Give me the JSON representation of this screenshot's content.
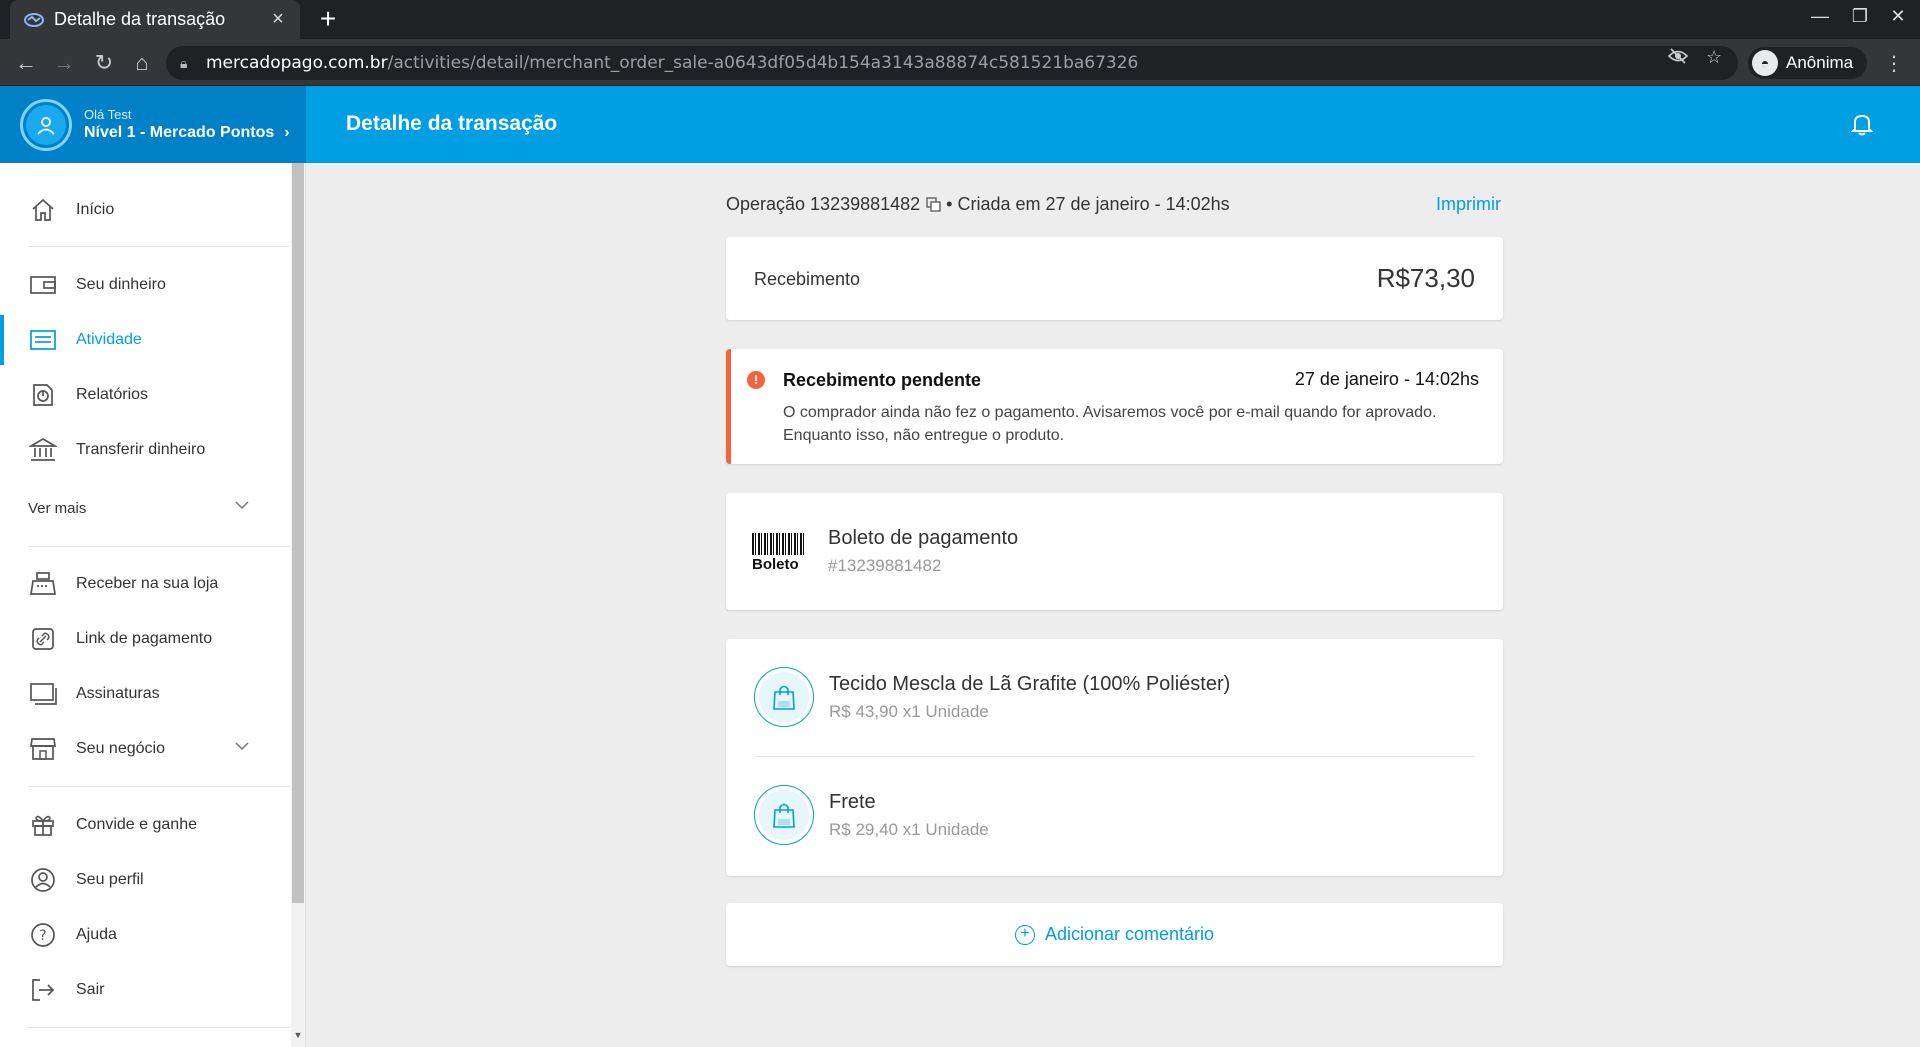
{
  "browser": {
    "tab_title": "Detalhe da transação",
    "url_host": "mercadopago.com.br",
    "url_path": "/activities/detail/merchant_order_sale-a0643df05d4b154a3143a88874c581521ba67326",
    "profile_label": "Anônima"
  },
  "header": {
    "greeting": "Olá Test",
    "level": "Nível 1 - Mercado Pontos",
    "page_title": "Detalhe da transação"
  },
  "sidebar": {
    "items": [
      {
        "label": "Início",
        "icon": "home-icon"
      },
      {
        "label": "Seu dinheiro",
        "icon": "wallet-icon"
      },
      {
        "label": "Atividade",
        "icon": "activity-icon",
        "active": true
      },
      {
        "label": "Relatórios",
        "icon": "report-icon"
      },
      {
        "label": "Transferir dinheiro",
        "icon": "bank-icon"
      },
      {
        "label": "Ver mais",
        "icon": "chevron-down-icon"
      },
      {
        "label": "Receber na sua loja",
        "icon": "cash-register-icon"
      },
      {
        "label": "Link de pagamento",
        "icon": "link-icon"
      },
      {
        "label": "Assinaturas",
        "icon": "subscriptions-icon"
      },
      {
        "label": "Seu negócio",
        "icon": "store-icon"
      },
      {
        "label": "Convide e ganhe",
        "icon": "gift-icon"
      },
      {
        "label": "Seu perfil",
        "icon": "user-icon"
      },
      {
        "label": "Ajuda",
        "icon": "help-icon"
      },
      {
        "label": "Sair",
        "icon": "logout-icon"
      }
    ]
  },
  "content": {
    "operation_prefix": "Operação 13239881482",
    "operation_suffix": "• Criada em 27 de janeiro - 14:02hs",
    "print_label": "Imprimir",
    "receipt_label": "Recebimento",
    "receipt_amount": "R$73,30",
    "pending": {
      "title": "Recebimento pendente",
      "date": "27 de janeiro - 14:02hs",
      "desc": "O comprador ainda não fez o pagamento. Avisaremos você por e-mail quando for aprovado. Enquanto isso, não entregue o produto."
    },
    "boleto": {
      "logo_text": "Boleto",
      "title": "Boleto de pagamento",
      "number": "#13239881482"
    },
    "items": [
      {
        "title": "Tecido Mescla de Lã Grafite (100% Poliéster)",
        "detail": "R$ 43,90 x1 Unidade"
      },
      {
        "title": "Frete",
        "detail": "R$ 29,40 x1 Unidade"
      }
    ],
    "comment_label": "Adicionar comentário"
  },
  "colors": {
    "brand": "#009ee3",
    "brand_dark": "#0080c6",
    "warning": "#f3643d"
  }
}
